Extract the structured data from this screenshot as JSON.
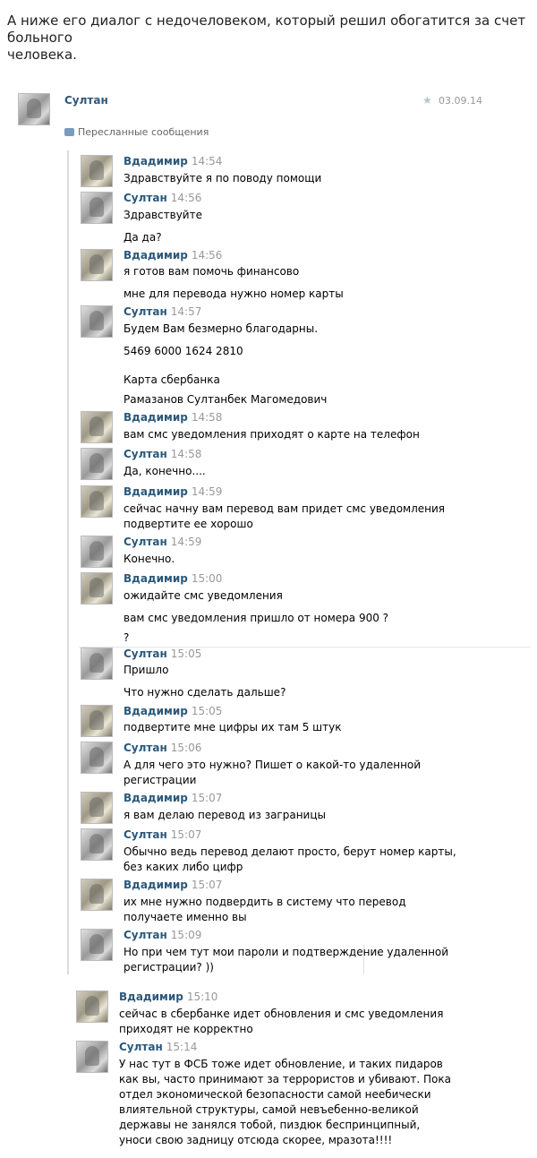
{
  "intro": {
    "line1": "А ниже его диалог с недочеловеком, который решил обогатится за счет больного",
    "line2": "человека."
  },
  "post": {
    "author": "Султан",
    "date": "03.09.14",
    "forwarded_label": "Пересланные сообщения"
  },
  "messages": [
    {
      "author": "Вдадимир",
      "time": "14:54",
      "lines": [
        "Здравствуйте я по поводу помощи"
      ]
    },
    {
      "author": "Султан",
      "time": "14:56",
      "lines": [
        "Здравствуйте",
        "Да да?"
      ]
    },
    {
      "author": "Вдадимир",
      "time": "14:56",
      "lines": [
        "я готов вам помочь финансово",
        "мне для перевода нужно номер карты"
      ]
    },
    {
      "author": "Султан",
      "time": "14:57",
      "lines": [
        "Будем Вам безмерно благодарны.",
        "5469 6000 1624 2810",
        "Карта сбербанка",
        "Рамазанов Султанбек Магомедович"
      ]
    },
    {
      "author": "Вдадимир",
      "time": "14:58",
      "lines": [
        "вам смс уведомления приходят о карте на телефон"
      ]
    },
    {
      "author": "Султан",
      "time": "14:58",
      "lines": [
        "Да, конечно...."
      ]
    },
    {
      "author": "Вдадимир",
      "time": "14:59",
      "lines": [
        "сейчас начну вам перевод вам придет смс уведомления",
        "подвертите ее хорошо"
      ]
    },
    {
      "author": "Султан",
      "time": "14:59",
      "lines": [
        "Конечно."
      ]
    },
    {
      "author": "Вдадимир",
      "time": "15:00",
      "lines": [
        "ожидайте смс уведомления",
        "вам смс уведомления пришло от номера 900 ?",
        "?"
      ]
    },
    {
      "author": "Султан",
      "time": "15:05",
      "lines": [
        "Пришло",
        "Что нужно сделать дальше?"
      ]
    },
    {
      "author": "Вдадимир",
      "time": "15:05",
      "lines": [
        "подвертите мне цифры их там 5 штук"
      ]
    },
    {
      "author": "Султан",
      "time": "15:06",
      "lines": [
        "А для чего это нужно? Пишет о какой-то удаленной",
        "регистрации"
      ]
    },
    {
      "author": "Вдадимир",
      "time": "15:07",
      "lines": [
        "я вам делаю перевод из заграницы"
      ]
    },
    {
      "author": "Султан",
      "time": "15:07",
      "lines": [
        "Обычно ведь перевод делают просто, берут номер карты,",
        "без каких либо цифр"
      ]
    },
    {
      "author": "Вдадимир",
      "time": "15:07",
      "lines": [
        "их мне нужно подвердить в систему что перевод",
        "получаете именно вы"
      ]
    },
    {
      "author": "Султан",
      "time": "15:09",
      "lines": [
        "Но при чем тут мои пароли и подтверждение удаленной",
        "регистрации? ))"
      ]
    },
    {
      "author": "Вдадимир",
      "time": "15:10",
      "lines": [
        "сейчас в сбербанке идет обновления и смс уведомления",
        "приходят не корректно"
      ]
    },
    {
      "author": "Султан",
      "time": "15:14",
      "lines": [
        "У нас тут в ФСБ тоже идет обновление, и таких пидаров",
        "как вы, часто принимают за террористов и убивают. Пока",
        "отдел экономической безопасности самой неебически",
        "влиятельной структуры, самой невъебенно-великой",
        "державы не занялся тобой, пиздюк беспринципный,",
        "уноси свою задницу отсюда скорее, мразота!!!!"
      ]
    }
  ]
}
